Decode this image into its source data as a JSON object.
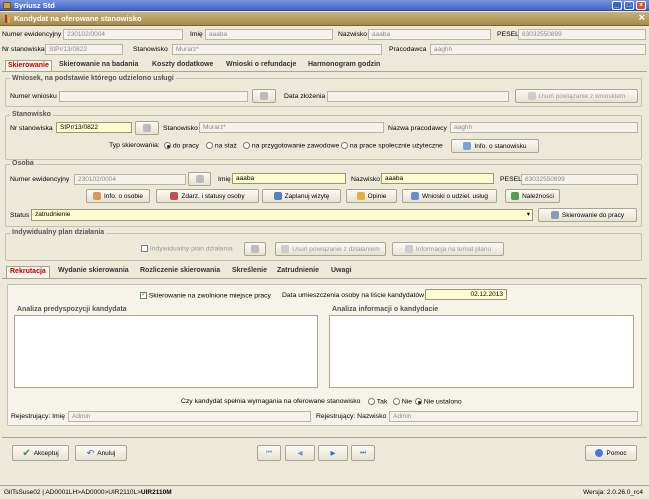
{
  "window": {
    "title": "Syriusz Std"
  },
  "dialog": {
    "title": "Kandydat na oferowane stanowisko"
  },
  "top": {
    "nr_ewid_label": "Numer ewidencyjny",
    "nr_ewid": "230102/0004",
    "imie_label": "Imię",
    "imie": "aaaba",
    "nazwisko_label": "Nazwisko",
    "nazwisko": "aaaba",
    "pesel_label": "PESEL",
    "pesel": "83032550899",
    "nr_stan_label": "Nr stanowiska",
    "nr_stan": "StPr/13/0822",
    "stanowisko_label": "Stanowisko",
    "stanowisko": "Murarz*",
    "pracodawca_label": "Pracodawca",
    "pracodawca": "aaghh"
  },
  "tabs": [
    "Skierowanie",
    "Skierowanie na badania",
    "Koszty dodatkowe",
    "Wnioski o refundacje",
    "Harmonogram godzin"
  ],
  "wniosek": {
    "title": "Wniosek, na podstawie którego udzielono usługi",
    "nr_label": "Numer wniosku",
    "data_label": "Data złożenia",
    "unlink_btn": "Usuń powiązanie z wnioskiem"
  },
  "stanowisko": {
    "title": "Stanowisko",
    "nr_label": "Nr stanowiska",
    "nr": "StPr/13/0822",
    "stan_label": "Stanowisko",
    "stan": "Murarz*",
    "prac_label": "Nazwa pracodawcy",
    "prac": "aaghh",
    "typ_label": "Typ skierowania:",
    "typ_options": [
      "do pracy",
      "na staż",
      "na przygotowanie zawodowe",
      "na prace społecznie użyteczne"
    ],
    "info_btn": "Info. o stanowisku"
  },
  "osoba": {
    "title": "Osoba",
    "nr_label": "Numer ewidencyjny",
    "nr": "230102/0004",
    "imie_label": "Imię",
    "imie": "aaaba",
    "nazwisko_label": "Nazwisko",
    "nazwisko": "aaaba",
    "pesel_label": "PESEL",
    "pesel": "83032550899",
    "buttons": [
      "Info. o osobie",
      "Zdarz. i statusy osoby",
      "Zaplanuj wizytę",
      "Opinie",
      "Wnioski o udziel. usług",
      "Należności"
    ],
    "status_label": "Status",
    "status": "zatrudnienie",
    "skier_btn": "Skierowanie do pracy"
  },
  "ipd": {
    "title": "Indywidualny plan działania",
    "chk_label": "Indywidualny plan działania",
    "unlink_btn": "Usuń powiązanie z działaniem",
    "info_btn": "Informacja na temat planu"
  },
  "tabs2": [
    "Rekrutacja",
    "Wydanie skierowania",
    "Rozliczenie skierowania",
    "Skreślenie",
    "Zatrudnienie",
    "Uwagi"
  ],
  "rekr": {
    "chk_label": "Skierowanie na zwolnione miejsce pracy",
    "data_label": "Data umieszczenia osoby na liście kandydatów",
    "data": "02.12.2013",
    "analiza1": "Analiza predyspozycji kandydata",
    "analiza2": "Analiza informacji o kandydacie",
    "question": "Czy kandydat spełnia wymagania na oferowane stanowisko",
    "answers": [
      "Tak",
      "Nie",
      "Nie ustalono"
    ],
    "rej_imie_label": "Rejestrujący: Imię",
    "rej_imie": "Admin",
    "rej_naz_label": "Rejestrujący: Nazwisko",
    "rej_naz": "Admin"
  },
  "footer": {
    "accept": "Akceptuj",
    "cancel": "Anuluj",
    "help": "Pomoc"
  },
  "statusbar": {
    "path_prefix": "GllTsSuse02 | AD0001LH>AD0000>UIR2110L>",
    "path_current": "UIR2110M",
    "version": "Wersja: 2.0.26.0_rc4"
  }
}
